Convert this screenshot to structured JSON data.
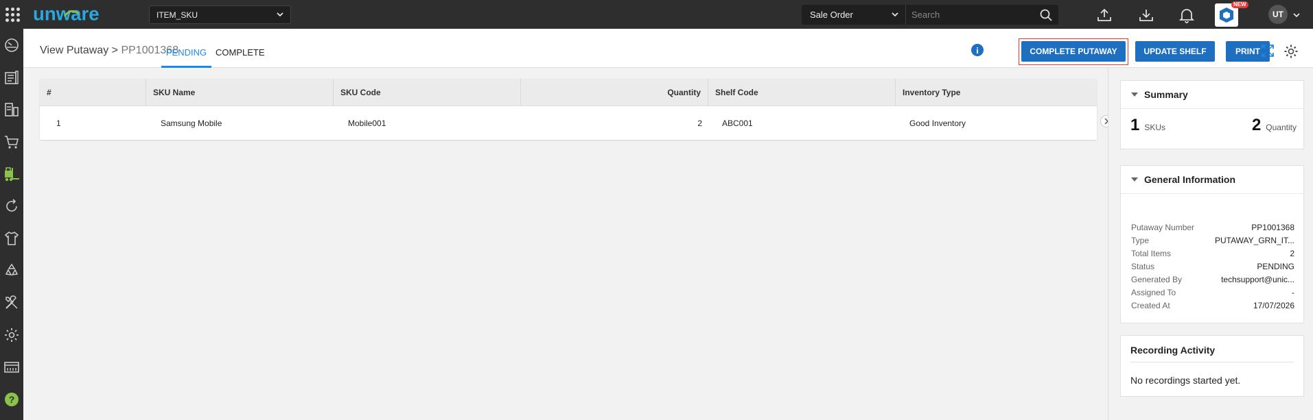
{
  "brand": {
    "logo_text": "unware"
  },
  "top": {
    "sku_select": "ITEM_SKU",
    "search_type": "Sale Order",
    "search_placeholder": "Search",
    "new_badge": "NEW",
    "avatar": "UT"
  },
  "sidebar": {
    "items": [
      "dashboard-icon",
      "orders-icon",
      "inventory-icon",
      "cart-icon",
      "forklift-icon",
      "returns-icon",
      "shirt-icon",
      "recycle-icon",
      "tools-icon",
      "settings-icon",
      "billing-icon",
      "help-icon"
    ],
    "active": "forklift-icon",
    "active_color": "#8bc34a"
  },
  "header": {
    "title": "View Putaway",
    "separator": ">",
    "code": "PP1001368",
    "tabs": [
      "PENDING",
      "COMPLETE"
    ],
    "active_tab": "PENDING",
    "buttons": {
      "complete_putaway": "COMPLETE PUTAWAY",
      "update_shelf": "UPDATE SHELF",
      "print": "PRINT"
    }
  },
  "table": {
    "columns": [
      "#",
      "SKU Name",
      "SKU Code",
      "Quantity",
      "Shelf Code",
      "Inventory Type"
    ],
    "rows": [
      {
        "num": "1",
        "sku_name": "Samsung Mobile",
        "sku_code": "Mobile001",
        "quantity": "2",
        "shelf_code": "ABC001",
        "inventory_type": "Good Inventory"
      }
    ]
  },
  "summary": {
    "title": "Summary",
    "skus_value": "1",
    "skus_label": "SKUs",
    "qty_value": "2",
    "qty_label": "Quantity"
  },
  "general": {
    "title": "General Information",
    "rows": [
      {
        "label": "Putaway Number",
        "value": "PP1001368"
      },
      {
        "label": "Type",
        "value": "PUTAWAY_GRN_IT..."
      },
      {
        "label": "Total Items",
        "value": "2"
      },
      {
        "label": "Status",
        "value": "PENDING"
      },
      {
        "label": "Generated By",
        "value": "techsupport@unic..."
      },
      {
        "label": "Assigned To",
        "value": "-"
      },
      {
        "label": "Created At",
        "value": "17/07/2026"
      }
    ]
  },
  "recording": {
    "title": "Recording Activity",
    "message": "No recordings started yet."
  },
  "colors": {
    "primary": "#1e6fc0",
    "tab_active": "#1e88e5",
    "highlight": "#e53935",
    "topbar": "#2e2e2e"
  }
}
